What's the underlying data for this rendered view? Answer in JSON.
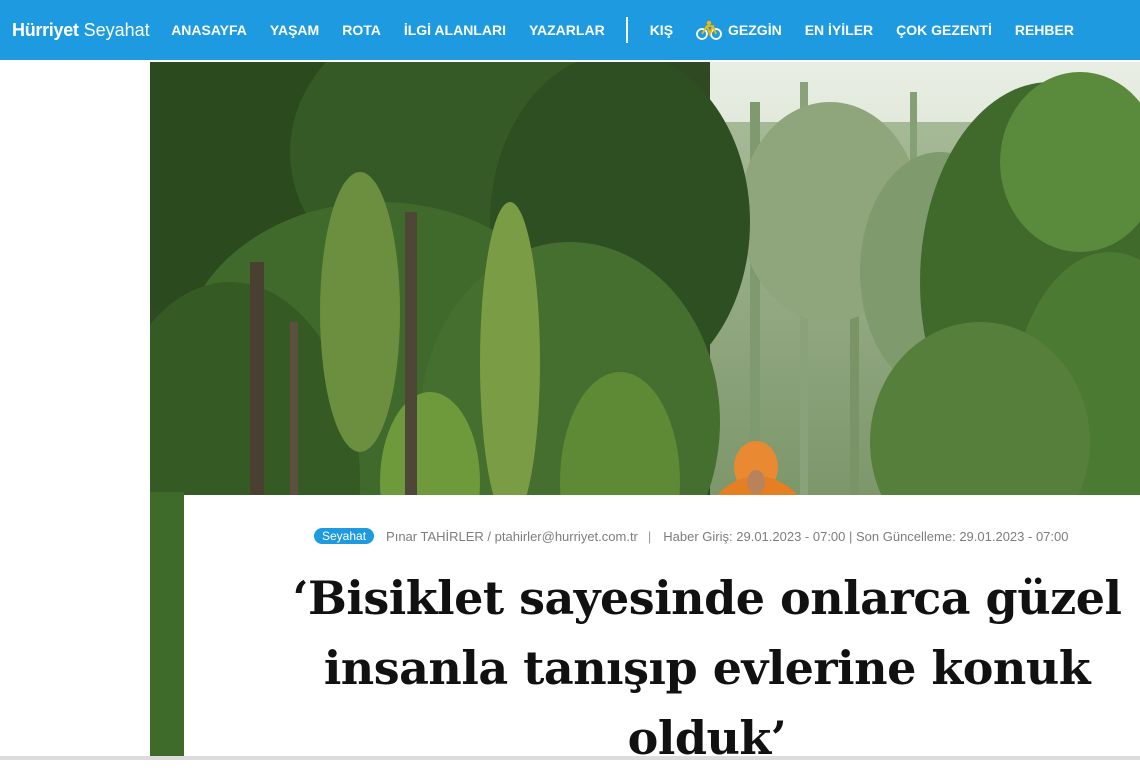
{
  "header": {
    "brand": "Hürriyet",
    "section": "Seyahat",
    "nav": [
      {
        "label": "ANASAYFA"
      },
      {
        "label": "YAŞAM"
      },
      {
        "label": "ROTA"
      },
      {
        "label": "İLGİ ALANLARI"
      },
      {
        "label": "YAZARLAR"
      }
    ],
    "nav_right": [
      {
        "label": "KIŞ"
      },
      {
        "label": "GEZGİN",
        "icon": "bicycle-icon"
      },
      {
        "label": "EN İYİLER"
      },
      {
        "label": "ÇOK GEZENTİ"
      },
      {
        "label": "REHBER"
      }
    ]
  },
  "article": {
    "category": "Seyahat",
    "author": "Pınar TAHİRLER / ptahirler@hurriyet.com.tr",
    "divider": "|",
    "dates": "Haber Giriş: 29.01.2023 - 07:00 | Son Güncelleme: 29.01.2023 - 07:00",
    "title": "‘Bisiklet sayesinde onlarca güzel insanla tanışıp evlerine konuk olduk’"
  },
  "colors": {
    "brand_blue": "#1e9be0",
    "text_dark": "#111111",
    "meta_gray": "#7d7d7d"
  }
}
